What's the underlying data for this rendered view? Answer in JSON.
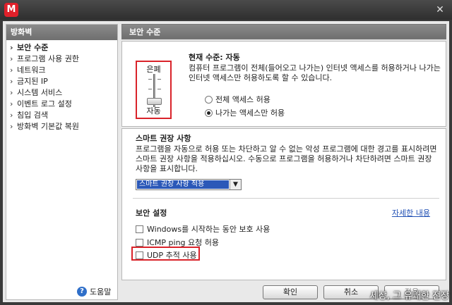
{
  "window": {
    "app_icon_letter": "M",
    "close_glyph": "✕"
  },
  "sidebar": {
    "title": "방화벽",
    "items": [
      {
        "label": "보안 수준",
        "active": true
      },
      {
        "label": "프로그램 사용 권한"
      },
      {
        "label": "네트워크"
      },
      {
        "label": "금지된 IP"
      },
      {
        "label": "시스템 서비스"
      },
      {
        "label": "이벤트 로그 설정"
      },
      {
        "label": "침입 검색"
      },
      {
        "label": "방화벽 기본값 복원"
      }
    ],
    "help_label": "도움말"
  },
  "main": {
    "title": "보안 수준",
    "level": {
      "top_label": "은폐",
      "bottom_label": "자동",
      "position": "bottom"
    },
    "current": {
      "title": "현재 수준: 자동",
      "description": "컴퓨터 프로그램이 전체(들어오고 나가는) 인터넷 액세스를 허용하거나 나가는 인터넷 액세스만 허용하도록 할 수 있습니다.",
      "options": [
        {
          "label": "전체 액세스 허용",
          "selected": false
        },
        {
          "label": "나가는 액세스만 허용",
          "selected": true
        }
      ]
    },
    "smart": {
      "title": "스마트 권장 사항",
      "description": "프로그램을 자동으로 허용 또는 차단하고 알 수 없는 악성 프로그램에 대한 경고를 표시하려면 스마트 권장 사항을 적용하십시오. 수동으로 프로그램을 허용하거나 차단하려면 스마트 권장 사항을 표시합니다.",
      "select_value": "스마트 권장 사항 적용"
    },
    "security": {
      "title": "보안 설정",
      "detail_link": "자세한 내용",
      "checks": [
        {
          "label": "Windows를 시작하는 동안 보호 사용",
          "checked": false
        },
        {
          "label": "ICMP ping 요청 허용",
          "checked": false
        },
        {
          "label": "UDP 추적 사용",
          "checked": false
        }
      ]
    },
    "buttons": {
      "ok": "확인",
      "cancel": "취소",
      "apply": "적용"
    }
  },
  "watermark": "세상, 그 유쾌한 전장",
  "colors": {
    "highlight_box": "#d9232a",
    "link": "#2352b5",
    "select_bg": "#2b58b8"
  }
}
